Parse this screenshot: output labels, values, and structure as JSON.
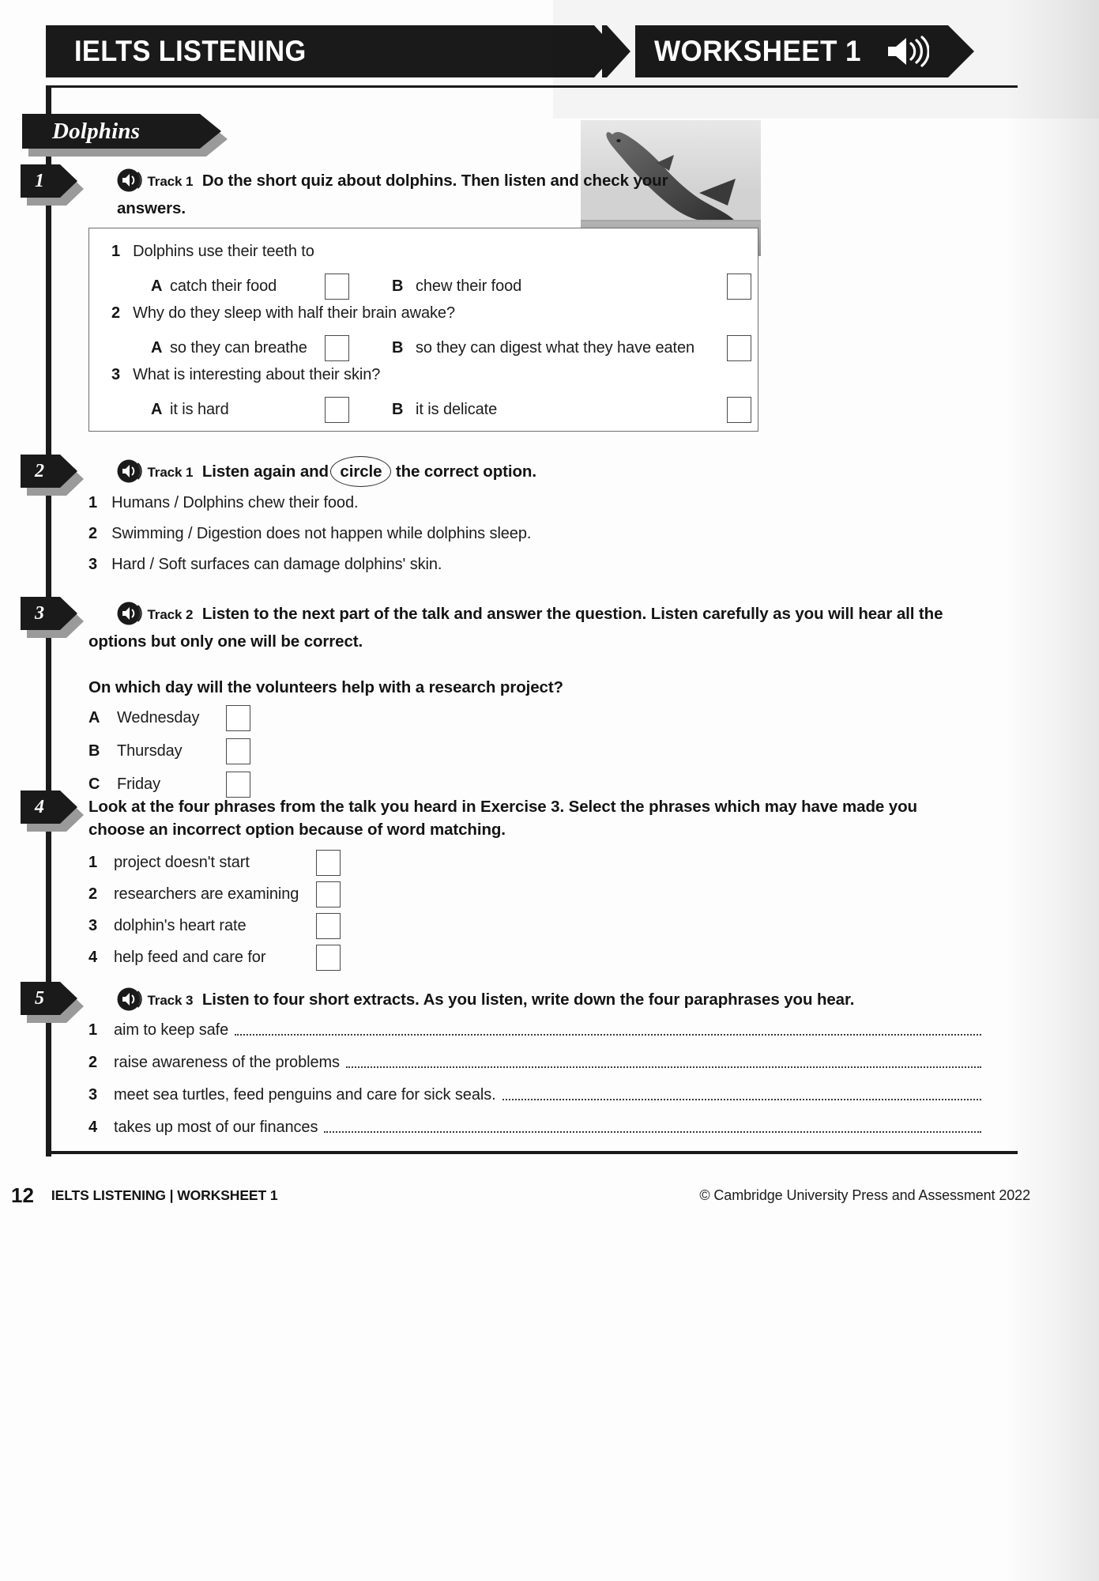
{
  "header": {
    "title": "IELTS LISTENING",
    "worksheet_label": "WORKSHEET 1",
    "speaker_icon": "speaker-icon"
  },
  "topic": {
    "title": "Dolphins"
  },
  "exercises": [
    {
      "number": "1",
      "track": "Track 1",
      "instruction": "Do the short quiz about dolphins. Then listen and check your answers.",
      "quiz": [
        {
          "number": "1",
          "question": "Dolphins use their teeth to",
          "option_a_letter": "A",
          "option_a": "catch their food",
          "option_b_letter": "B",
          "option_b": "chew their food"
        },
        {
          "number": "2",
          "question": "Why do they sleep with half their brain awake?",
          "option_a_letter": "A",
          "option_a": "so they can breathe",
          "option_b_letter": "B",
          "option_b": "so they can digest what they have eaten"
        },
        {
          "number": "3",
          "question": "What is interesting about their skin?",
          "option_a_letter": "A",
          "option_a": "it is hard",
          "option_b_letter": "B",
          "option_b": "it is delicate"
        }
      ]
    },
    {
      "number": "2",
      "track": "Track 1",
      "instruction_pre": "Listen again and",
      "instruction_circled": "circle",
      "instruction_post": "the correct option.",
      "items": [
        {
          "number": "1",
          "text": "Humans / Dolphins chew their food."
        },
        {
          "number": "2",
          "text": "Swimming / Digestion does not happen while dolphins sleep."
        },
        {
          "number": "3",
          "text": "Hard / Soft surfaces can damage dolphins' skin."
        }
      ]
    },
    {
      "number": "3",
      "track": "Track 2",
      "instruction": "Listen to the next part of the talk and answer the question. Listen carefully as you will hear all the options but only one will be correct.",
      "question": "On which day will the volunteers help with a research project?",
      "options": [
        {
          "letter": "A",
          "text": "Wednesday"
        },
        {
          "letter": "B",
          "text": "Thursday"
        },
        {
          "letter": "C",
          "text": "Friday"
        }
      ]
    },
    {
      "number": "4",
      "instruction": "Look at the four phrases from the talk you heard in Exercise 3. Select the phrases which may have made you choose an incorrect option because of word matching.",
      "items": [
        {
          "number": "1",
          "text": "project doesn't start"
        },
        {
          "number": "2",
          "text": "researchers are examining"
        },
        {
          "number": "3",
          "text": "dolphin's heart rate"
        },
        {
          "number": "4",
          "text": "help feed and care for"
        }
      ]
    },
    {
      "number": "5",
      "track": "Track 3",
      "instruction": "Listen to four short extracts. As you listen, write down the four paraphrases you hear.",
      "items": [
        {
          "number": "1",
          "text": "aim to keep safe"
        },
        {
          "number": "2",
          "text": "raise awareness of the problems"
        },
        {
          "number": "3",
          "text": "meet sea turtles, feed penguins and care for sick seals."
        },
        {
          "number": "4",
          "text": "takes up most of our finances"
        }
      ]
    }
  ],
  "footer": {
    "page_number": "12",
    "label": "IELTS LISTENING  |  WORKSHEET 1",
    "copyright": "© Cambridge University Press and Assessment 2022"
  },
  "colors": {
    "ink": "#1a1a1a",
    "paper": "#ffffff",
    "shadow": "#9a9a9a"
  }
}
